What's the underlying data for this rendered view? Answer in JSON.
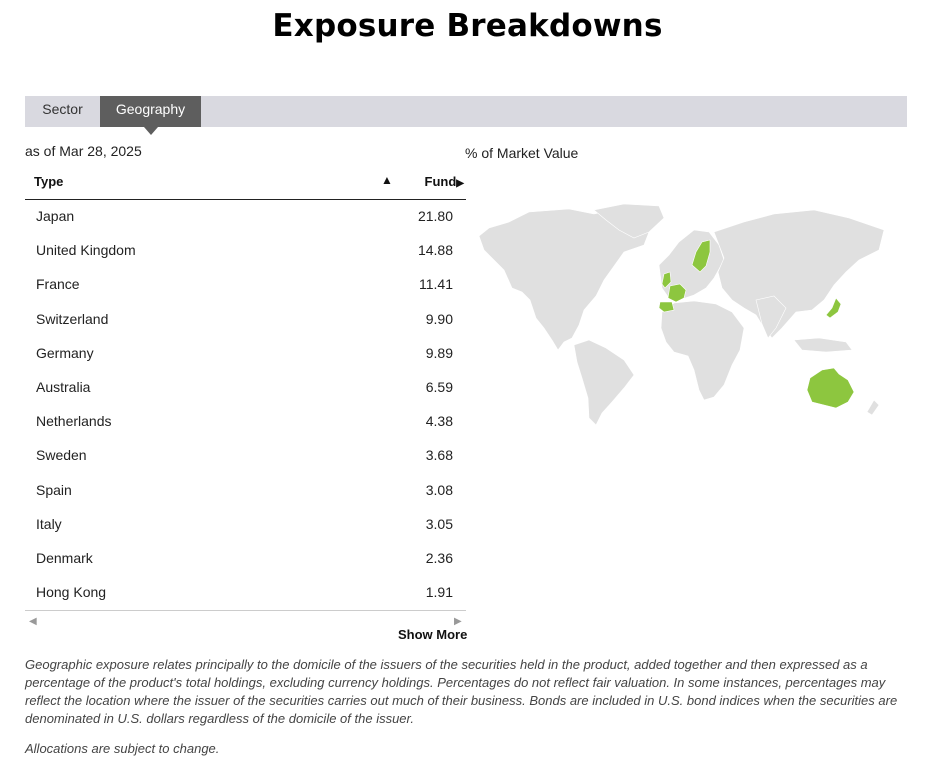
{
  "page": {
    "title": "Exposure Breakdowns",
    "as_of": "as of Mar 28, 2025",
    "market_value_label": "% of Market Value",
    "show_more": "Show More",
    "disclaimer": "Geographic exposure relates principally to the domicile of the issuers of the securities held in the product, added together and then expressed as a percentage of the product's total holdings, excluding currency holdings. Percentages do not reflect fair valuation. In some instances, percentages may reflect the location where the issuer of the securities carries out much of their business. Bonds are included in U.S. bond indices when the securities are denominated in U.S. dollars regardless of the domicile of the issuer.",
    "allocations_note": "Allocations are subject to change."
  },
  "tabs": [
    {
      "label": "Sector",
      "active": false
    },
    {
      "label": "Geography",
      "active": true
    }
  ],
  "table": {
    "col_type": "Type",
    "col_fund": "Fund",
    "sort_indicator": "▲",
    "fund_indicator": "▶",
    "rows": [
      {
        "name": "Japan",
        "value": "21.80"
      },
      {
        "name": "United Kingdom",
        "value": "14.88"
      },
      {
        "name": "France",
        "value": "11.41"
      },
      {
        "name": "Switzerland",
        "value": "9.90"
      },
      {
        "name": "Germany",
        "value": "9.89"
      },
      {
        "name": "Australia",
        "value": "6.59"
      },
      {
        "name": "Netherlands",
        "value": "4.38"
      },
      {
        "name": "Sweden",
        "value": "3.68"
      },
      {
        "name": "Spain",
        "value": "3.08"
      },
      {
        "name": "Italy",
        "value": "3.05"
      },
      {
        "name": "Denmark",
        "value": "2.36"
      },
      {
        "name": "Hong Kong",
        "value": "1.91"
      }
    ]
  },
  "map": {
    "base_color": "#e0e0e0",
    "highlight_color": "#8dc63f"
  }
}
